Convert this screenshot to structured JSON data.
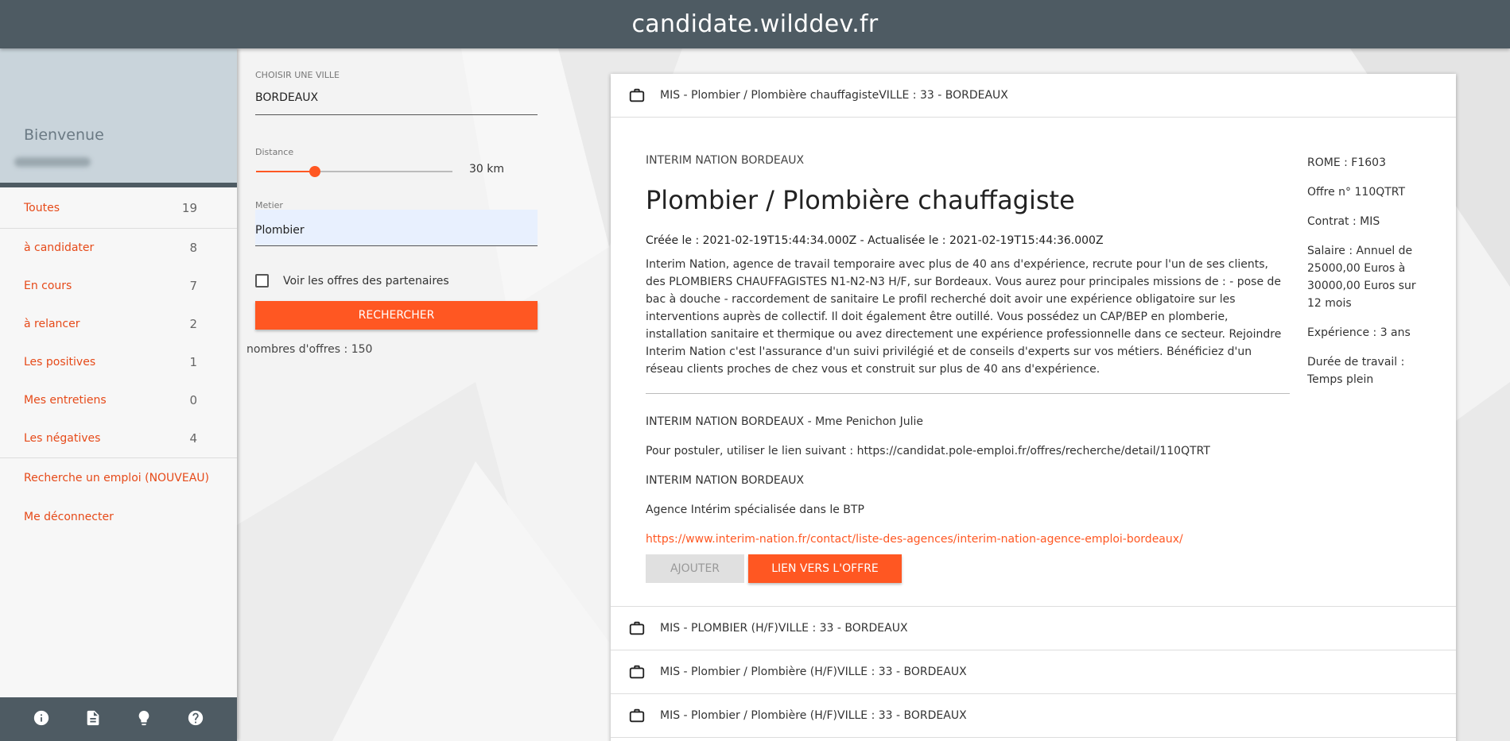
{
  "header": {
    "title": "candidate.wilddev.fr"
  },
  "sidebar": {
    "welcome": "Bienvenue",
    "items": [
      {
        "label": "Toutes",
        "count": "19"
      },
      {
        "label": "à candidater",
        "count": "8"
      },
      {
        "label": "En cours",
        "count": "7"
      },
      {
        "label": "à relancer",
        "count": "2"
      },
      {
        "label": "Les positives",
        "count": "1"
      },
      {
        "label": "Mes entretiens",
        "count": "0"
      },
      {
        "label": "Les négatives",
        "count": "4"
      }
    ],
    "links": [
      "Recherche un emploi (NOUVEAU)",
      "Me déconnecter"
    ],
    "footer_icons": [
      "info-icon",
      "document-icon",
      "lightbulb-icon",
      "help-icon"
    ]
  },
  "search": {
    "city_label": "CHOISIR UNE VILLE",
    "city_value": "BORDEAUX",
    "distance_label": "Distance",
    "distance_value": "30 km",
    "distance_fraction": 0.3,
    "metier_label": "Metier",
    "metier_value": "Plombier",
    "partners_label": "Voir les offres des partenaires",
    "partners_checked": false,
    "button": "RECHERCHER",
    "count_text": "nombres d'offres : 150"
  },
  "offers": {
    "expanded": {
      "header": "MIS - Plombier / Plombière chauffagisteVILLE : 33 - BORDEAUX",
      "company": "INTERIM NATION BORDEAUX",
      "title": "Plombier / Plombière chauffagiste",
      "dates": "Créée le : 2021-02-19T15:44:34.000Z - Actualisée le : 2021-02-19T15:44:36.000Z",
      "description": "Interim Nation, agence de travail temporaire avec plus de 40 ans d'expérience, recrute pour l'un de ses clients, des PLOMBIERS CHAUFFAGISTES N1-N2-N3 H/F, sur Bordeaux. Vous aurez pour principales missions de : - pose de bac à douche - raccordement de sanitaire Le profil recherché doit avoir une expérience obligatoire sur les interventions auprès de collectif. Il doit également être outillé. Vous possédez un CAP/BEP en plomberie, installation sanitaire et thermique ou avez directement une expérience professionnelle dans ce secteur. Rejoindre Interim Nation c'est l'assurance d'un suivi privilégié et de conseils d'experts sur vos métiers. Bénéficiez d'un réseau clients proches de chez vous et construit sur plus de 40 ans d'expérience.",
      "contact": "INTERIM NATION BORDEAUX - Mme Penichon Julie",
      "apply": "Pour postuler, utiliser le lien suivant : https://candidat.pole-emploi.fr/offres/recherche/detail/110QTRT",
      "company2": "INTERIM NATION BORDEAUX",
      "agency": "Agence Intérim spécialisée dans le BTP",
      "url": "https://www.interim-nation.fr/contact/liste-des-agences/interim-nation-agence-emploi-bordeaux/",
      "btn_add": "AJOUTER",
      "btn_link": "LIEN VERS L'OFFRE",
      "side": {
        "rome": "ROME : F1603",
        "offre": "Offre n° 110QTRT",
        "contrat": "Contrat : MIS",
        "salaire": "Salaire : Annuel de 25000,00 Euros à 30000,00 Euros sur 12 mois",
        "experience": "Expérience : 3 ans",
        "duree": "Durée de travail : Temps plein"
      }
    },
    "collapsed": [
      "MIS - PLOMBIER (H/F)VILLE : 33 - BORDEAUX",
      "MIS - Plombier / Plombière (H/F)VILLE : 33 - BORDEAUX",
      "MIS - Plombier / Plombière (H/F)VILLE : 33 - BORDEAUX"
    ]
  }
}
